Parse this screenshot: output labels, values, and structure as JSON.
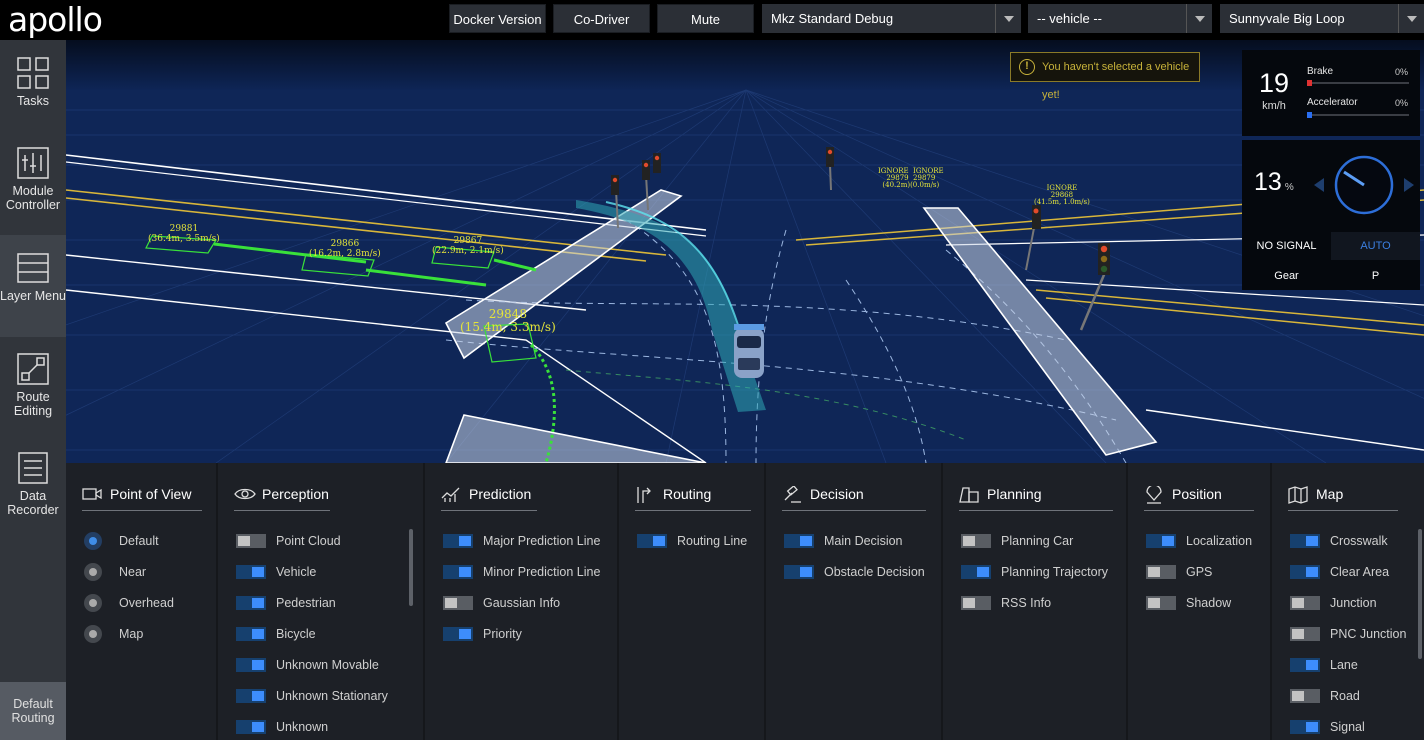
{
  "header": {
    "logo": "apollo",
    "buttons": [
      "Docker Version",
      "Co-Driver",
      "Mute"
    ],
    "selects": [
      "Mkz Standard Debug",
      "-- vehicle --",
      "Sunnyvale Big Loop"
    ]
  },
  "sidenav": {
    "items": [
      {
        "label": "Tasks",
        "icon": "tasks-grid-icon"
      },
      {
        "label": "Module Controller",
        "icon": "module-controller-icon"
      },
      {
        "label": "Layer Menu",
        "icon": "layer-menu-icon"
      },
      {
        "label": "Route Editing",
        "icon": "route-editing-icon"
      },
      {
        "label": "Data Recorder",
        "icon": "data-recorder-icon"
      }
    ],
    "active": "Layer Menu",
    "default_routing": "Default Routing"
  },
  "scene": {
    "warning": "You haven't selected a vehicle yet!",
    "dashboard": {
      "speed": "19",
      "speed_unit": "km/h",
      "brake_label": "Brake",
      "brake_pct": "0%",
      "accel_label": "Accelerator",
      "accel_pct": "0%",
      "steering": "13",
      "steering_unit": "%",
      "signal": "NO SIGNAL",
      "drive_mode": "AUTO",
      "gear_label": "Gear",
      "gear_value": "P"
    },
    "obstacle_labels": [
      "29881\n(36.4m, 3.5m/s)",
      "29866\n(16.2m, 2.8m/s)",
      "29867\n(22.9m, 2.1m/s)",
      "29848\n(15.4m, 3.3m/s)",
      "IGNORE  IGNORE\n29879  29879\n(40.2m)(0.0m/s)",
      "IGNORE\n29868\n(41.5m, 1.0m/s)"
    ]
  },
  "layers": {
    "point_of_view": {
      "title": "Point of View",
      "options": [
        {
          "label": "Default",
          "on": true
        },
        {
          "label": "Near",
          "on": false
        },
        {
          "label": "Overhead",
          "on": false
        },
        {
          "label": "Map",
          "on": false
        }
      ]
    },
    "perception": {
      "title": "Perception",
      "options": [
        {
          "label": "Point Cloud",
          "on": false
        },
        {
          "label": "Vehicle",
          "on": true
        },
        {
          "label": "Pedestrian",
          "on": true
        },
        {
          "label": "Bicycle",
          "on": true
        },
        {
          "label": "Unknown Movable",
          "on": true
        },
        {
          "label": "Unknown Stationary",
          "on": true
        },
        {
          "label": "Unknown",
          "on": true
        }
      ]
    },
    "prediction": {
      "title": "Prediction",
      "options": [
        {
          "label": "Major Prediction Line",
          "on": true
        },
        {
          "label": "Minor Prediction Line",
          "on": true
        },
        {
          "label": "Gaussian Info",
          "on": false
        },
        {
          "label": "Priority",
          "on": true
        }
      ]
    },
    "routing": {
      "title": "Routing",
      "options": [
        {
          "label": "Routing Line",
          "on": true
        }
      ]
    },
    "decision": {
      "title": "Decision",
      "options": [
        {
          "label": "Main Decision",
          "on": true
        },
        {
          "label": "Obstacle Decision",
          "on": true
        }
      ]
    },
    "planning": {
      "title": "Planning",
      "options": [
        {
          "label": "Planning Car",
          "on": false
        },
        {
          "label": "Planning Trajectory",
          "on": true
        },
        {
          "label": "RSS Info",
          "on": false
        }
      ]
    },
    "position": {
      "title": "Position",
      "options": [
        {
          "label": "Localization",
          "on": true
        },
        {
          "label": "GPS",
          "on": false
        },
        {
          "label": "Shadow",
          "on": false
        }
      ]
    },
    "map": {
      "title": "Map",
      "options": [
        {
          "label": "Crosswalk",
          "on": true
        },
        {
          "label": "Clear Area",
          "on": true
        },
        {
          "label": "Junction",
          "on": false
        },
        {
          "label": "PNC Junction",
          "on": false
        },
        {
          "label": "Lane",
          "on": true
        },
        {
          "label": "Road",
          "on": false
        },
        {
          "label": "Signal",
          "on": true
        }
      ]
    }
  },
  "colors": {
    "accent": "#3d8dfc",
    "scene_bg": "#0c1e45",
    "prediction": "#39e13a",
    "warning": "#c7b23a",
    "brake": "#e03232",
    "accelerator": "#2a6ef0"
  }
}
